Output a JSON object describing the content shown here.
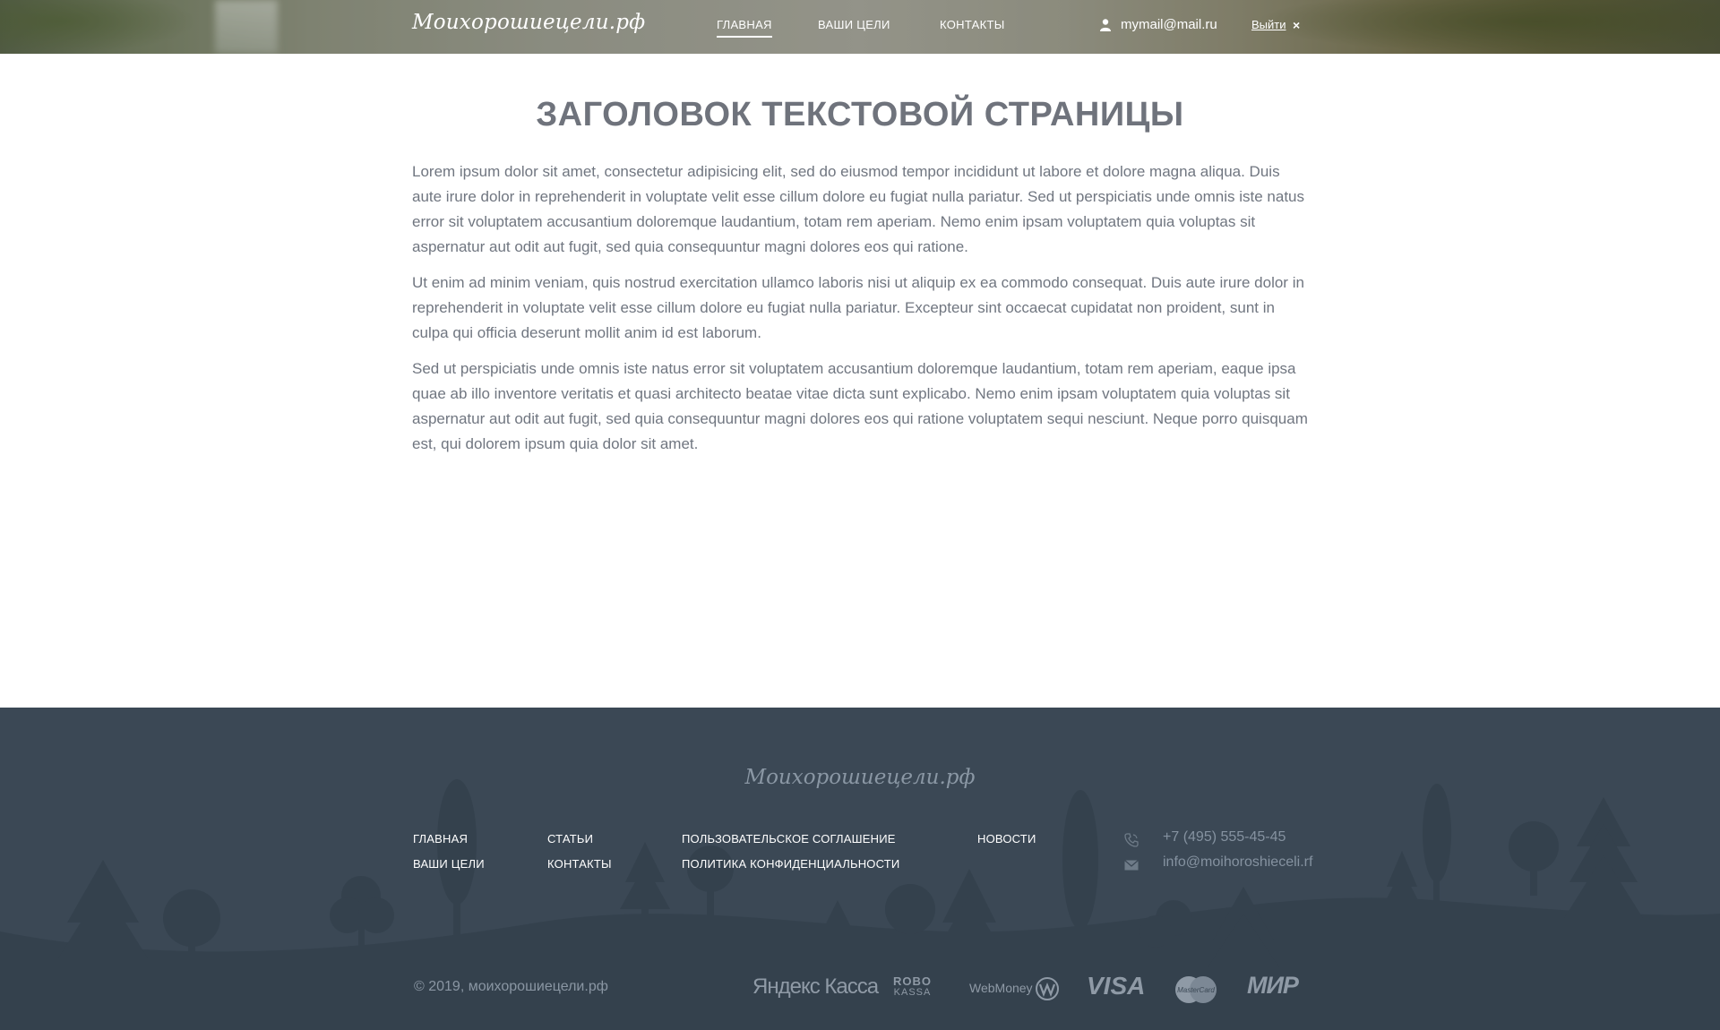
{
  "header": {
    "logo": "Моихорошиецели.рф",
    "nav": [
      {
        "label": "ГЛАВНАЯ",
        "active": true
      },
      {
        "label": "ВАШИ ЦЕЛИ",
        "active": false
      },
      {
        "label": "КОНТАКТЫ",
        "active": false
      }
    ],
    "user_email": "mymail@mail.ru",
    "logout_label": "Выйти",
    "logout_icon": "×"
  },
  "main": {
    "title": "ЗАГОЛОВОК ТЕКСТОВОЙ СТРАНИЦЫ",
    "paragraphs": [
      "Lorem ipsum dolor sit amet, consectetur adipisicing elit, sed do eiusmod tempor incididunt ut labore et dolore magna aliqua. Duis aute irure dolor in reprehenderit in voluptate velit esse cillum dolore eu fugiat nulla pariatur. Sed ut perspiciatis unde omnis iste natus error sit voluptatem accusantium doloremque laudantium, totam rem aperiam. Nemo enim ipsam voluptatem quia voluptas sit aspernatur aut odit aut fugit, sed quia consequuntur magni dolores eos qui ratione.",
      "Ut enim ad minim veniam, quis nostrud exercitation ullamco laboris nisi ut aliquip ex ea commodo consequat. Duis aute irure dolor in reprehenderit in voluptate velit esse cillum dolore eu fugiat nulla pariatur. Excepteur sint occaecat cupidatat non proident, sunt in culpa qui officia deserunt mollit anim id est laborum.",
      "Sed ut perspiciatis unde omnis iste natus error sit voluptatem accusantium doloremque laudantium, totam rem aperiam, eaque ipsa quae ab illo inventore veritatis et quasi architecto beatae vitae dicta sunt explicabo. Nemo enim ipsam voluptatem quia voluptas sit aspernatur aut odit aut fugit, sed quia consequuntur magni dolores eos qui ratione voluptatem sequi nesciunt. Neque porro quisquam est, qui dolorem ipsum quia dolor sit amet."
    ]
  },
  "footer": {
    "logo": "Моихорошиецели.рф",
    "links": [
      "ГЛАВНАЯ",
      "ВАШИ ЦЕЛИ",
      "СТАТЬИ",
      "КОНТАКТЫ",
      "ПОЛЬЗОВАТЕЛЬСКОЕ СОГЛАШЕНИЕ",
      "ПОЛИТИКА КОНФИДЕНЦИАЛЬНОСТИ",
      "НОВОСТИ"
    ],
    "phone": "+7 (495) 555-45-45",
    "email": "info@moihoroshieceli.rf",
    "copyright": "© 2019, моихорошиецели.рф",
    "payments": {
      "yandex": "Яндекс Касса",
      "robokassa_line1": "ROBO",
      "robokassa_line2": "KASSA",
      "webmoney": "WebMoney",
      "visa": "VISA",
      "mastercard": "MasterCard",
      "mir": "МИР"
    }
  },
  "colors": {
    "footer_bg": "#3b4855",
    "footer_silhouette": "#34414d",
    "title": "#6f737c",
    "body_text": "#707680",
    "footer_muted": "#8592a0"
  }
}
